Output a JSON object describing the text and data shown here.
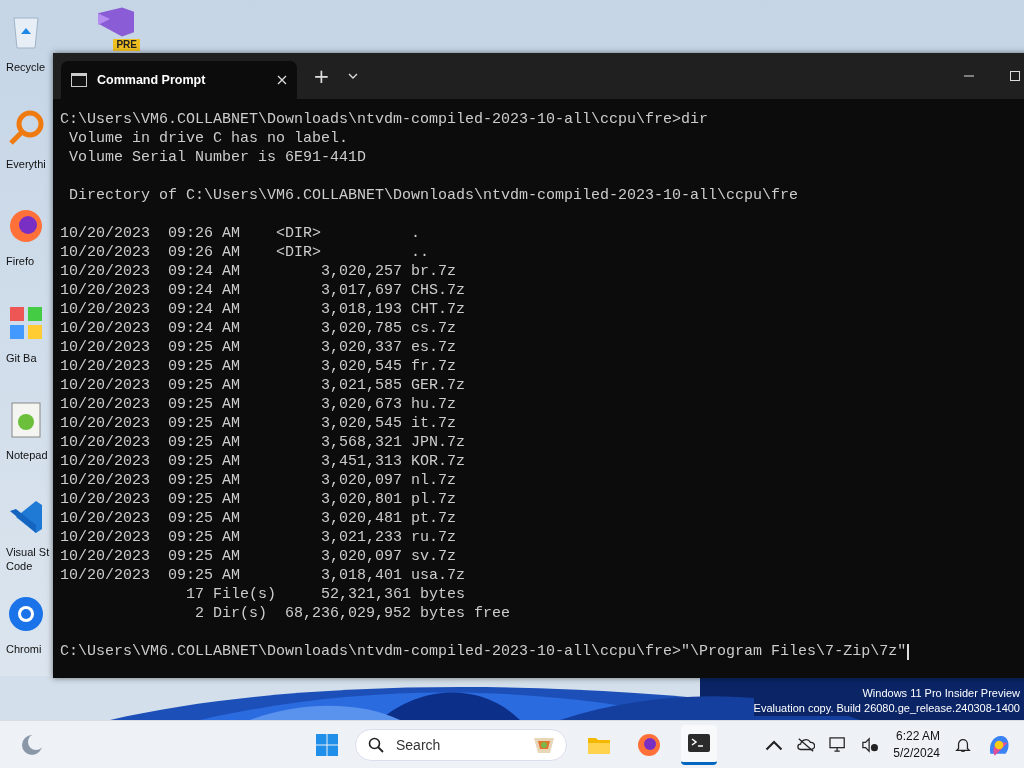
{
  "desktop_icons": [
    {
      "label": "Recycle"
    },
    {
      "label": "Everythi"
    },
    {
      "label": "Firefo"
    },
    {
      "label": "Git Ba"
    },
    {
      "label": "Notepad"
    },
    {
      "label": "Visual St Code"
    },
    {
      "label": "Chromi"
    }
  ],
  "desktop_top_icon": {
    "badge": "PRE"
  },
  "watermark": [
    "Windows 11 Pro Insider Preview",
    "Evaluation copy. Build 26080.ge_release.240308-1400"
  ],
  "window": {
    "tabs": [
      {
        "title": "Command Prompt",
        "selected": true
      }
    ],
    "new_tab": "+"
  },
  "terminal": {
    "blocks": [
      [
        "C:\\Users\\VM6.COLLABNET\\Downloads\\ntvdm-compiled-2023-10-all\\ccpu\\fre>dir",
        " Volume in drive C has no label.",
        " Volume Serial Number is 6E91-441D"
      ],
      [
        " Directory of C:\\Users\\VM6.COLLABNET\\Downloads\\ntvdm-compiled-2023-10-all\\ccpu\\fre"
      ],
      [
        "10/20/2023  09:26 AM    <DIR>          .",
        "10/20/2023  09:26 AM    <DIR>          ..",
        "10/20/2023  09:24 AM         3,020,257 br.7z",
        "10/20/2023  09:24 AM         3,017,697 CHS.7z",
        "10/20/2023  09:24 AM         3,018,193 CHT.7z",
        "10/20/2023  09:24 AM         3,020,785 cs.7z",
        "10/20/2023  09:25 AM         3,020,337 es.7z",
        "10/20/2023  09:25 AM         3,020,545 fr.7z",
        "10/20/2023  09:25 AM         3,021,585 GER.7z",
        "10/20/2023  09:25 AM         3,020,673 hu.7z",
        "10/20/2023  09:25 AM         3,020,545 it.7z",
        "10/20/2023  09:25 AM         3,568,321 JPN.7z",
        "10/20/2023  09:25 AM         3,451,313 KOR.7z",
        "10/20/2023  09:25 AM         3,020,097 nl.7z",
        "10/20/2023  09:25 AM         3,020,801 pl.7z",
        "10/20/2023  09:25 AM         3,020,481 pt.7z",
        "10/20/2023  09:25 AM         3,021,233 ru.7z",
        "10/20/2023  09:25 AM         3,020,097 sv.7z",
        "10/20/2023  09:25 AM         3,018,401 usa.7z",
        "              17 File(s)     52,321,361 bytes",
        "               2 Dir(s)  68,236,029,952 bytes free"
      ]
    ],
    "input_line": {
      "prompt": "C:\\Users\\VM6.COLLABNET\\Downloads\\ntvdm-compiled-2023-10-all\\ccpu\\fre>",
      "typed": "\"\\Program Files\\7-Zip\\7z\""
    }
  },
  "taskbar": {
    "search": {
      "placeholder": "Search"
    },
    "apps": [
      {
        "selected": false
      },
      {
        "selected": false
      },
      {
        "selected": true
      }
    ],
    "time": "6:22 AM",
    "date": "5/2/2024"
  }
}
